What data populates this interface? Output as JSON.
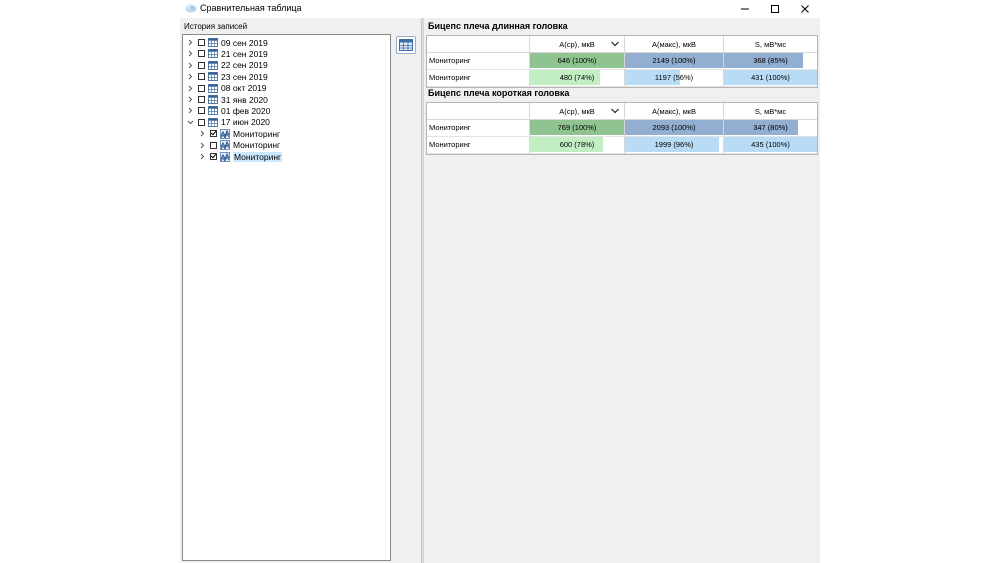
{
  "window": {
    "title": "Сравнительная таблица"
  },
  "history": {
    "label": "История записей",
    "dates": [
      {
        "label": "09 сен 2019",
        "expanded": false
      },
      {
        "label": "21 сен 2019",
        "expanded": false
      },
      {
        "label": "22 сен 2019",
        "expanded": false
      },
      {
        "label": "23 сен 2019",
        "expanded": false
      },
      {
        "label": "08 окт 2019",
        "expanded": false
      },
      {
        "label": "31 янв 2020",
        "expanded": false
      },
      {
        "label": "01 фев 2020",
        "expanded": false
      },
      {
        "label": "17 июн 2020",
        "expanded": true
      }
    ],
    "children": [
      {
        "label": "Мониторинг",
        "checked": true,
        "selected": false
      },
      {
        "label": "Мониторинг",
        "checked": false,
        "selected": false
      },
      {
        "label": "Мониторинг",
        "checked": true,
        "selected": true
      }
    ]
  },
  "sections": [
    {
      "title": "Бицепс плеча длинная головка",
      "columns": [
        "A(ср), мкВ",
        "A(макс), мкВ",
        "S, мВ*мс"
      ],
      "rows": [
        {
          "label": "Мониторинг",
          "cells": [
            {
              "text": "646 (100%)",
              "fraction": 1.0
            },
            {
              "text": "2149 (100%)",
              "fraction": 1.0
            },
            {
              "text": "368 (85%)",
              "fraction": 0.85
            }
          ],
          "style": "primary"
        },
        {
          "label": "Мониторинг",
          "cells": [
            {
              "text": "480 (74%)",
              "fraction": 0.74
            },
            {
              "text": "1197 (56%)",
              "fraction": 0.56
            },
            {
              "text": "431 (100%)",
              "fraction": 1.0
            }
          ],
          "style": "secondary"
        }
      ]
    },
    {
      "title": "Бицепс плеча короткая головка",
      "columns": [
        "A(ср), мкВ",
        "A(макс), мкВ",
        "S, мВ*мс"
      ],
      "rows": [
        {
          "label": "Мониторинг",
          "cells": [
            {
              "text": "769 (100%)",
              "fraction": 1.0
            },
            {
              "text": "2093 (100%)",
              "fraction": 1.0
            },
            {
              "text": "347 (80%)",
              "fraction": 0.8
            }
          ],
          "style": "primary"
        },
        {
          "label": "Мониторинг",
          "cells": [
            {
              "text": "600 (78%)",
              "fraction": 0.78
            },
            {
              "text": "1999 (96%)",
              "fraction": 0.96
            },
            {
              "text": "435 (100%)",
              "fraction": 1.0
            }
          ],
          "style": "secondary"
        }
      ]
    }
  ],
  "colors": {
    "primary_green": "#8fc490",
    "secondary_green": "#c3eec4",
    "primary_blue": "#92aed0",
    "secondary_blue": "#b9dcf6"
  },
  "icons": {
    "app": "cloud-icon",
    "minimize": "minimize-icon",
    "maximize": "maximize-icon",
    "close": "close-icon",
    "date": "calendar-icon",
    "record": "monitoring-icon",
    "table_button": "table-icon"
  }
}
